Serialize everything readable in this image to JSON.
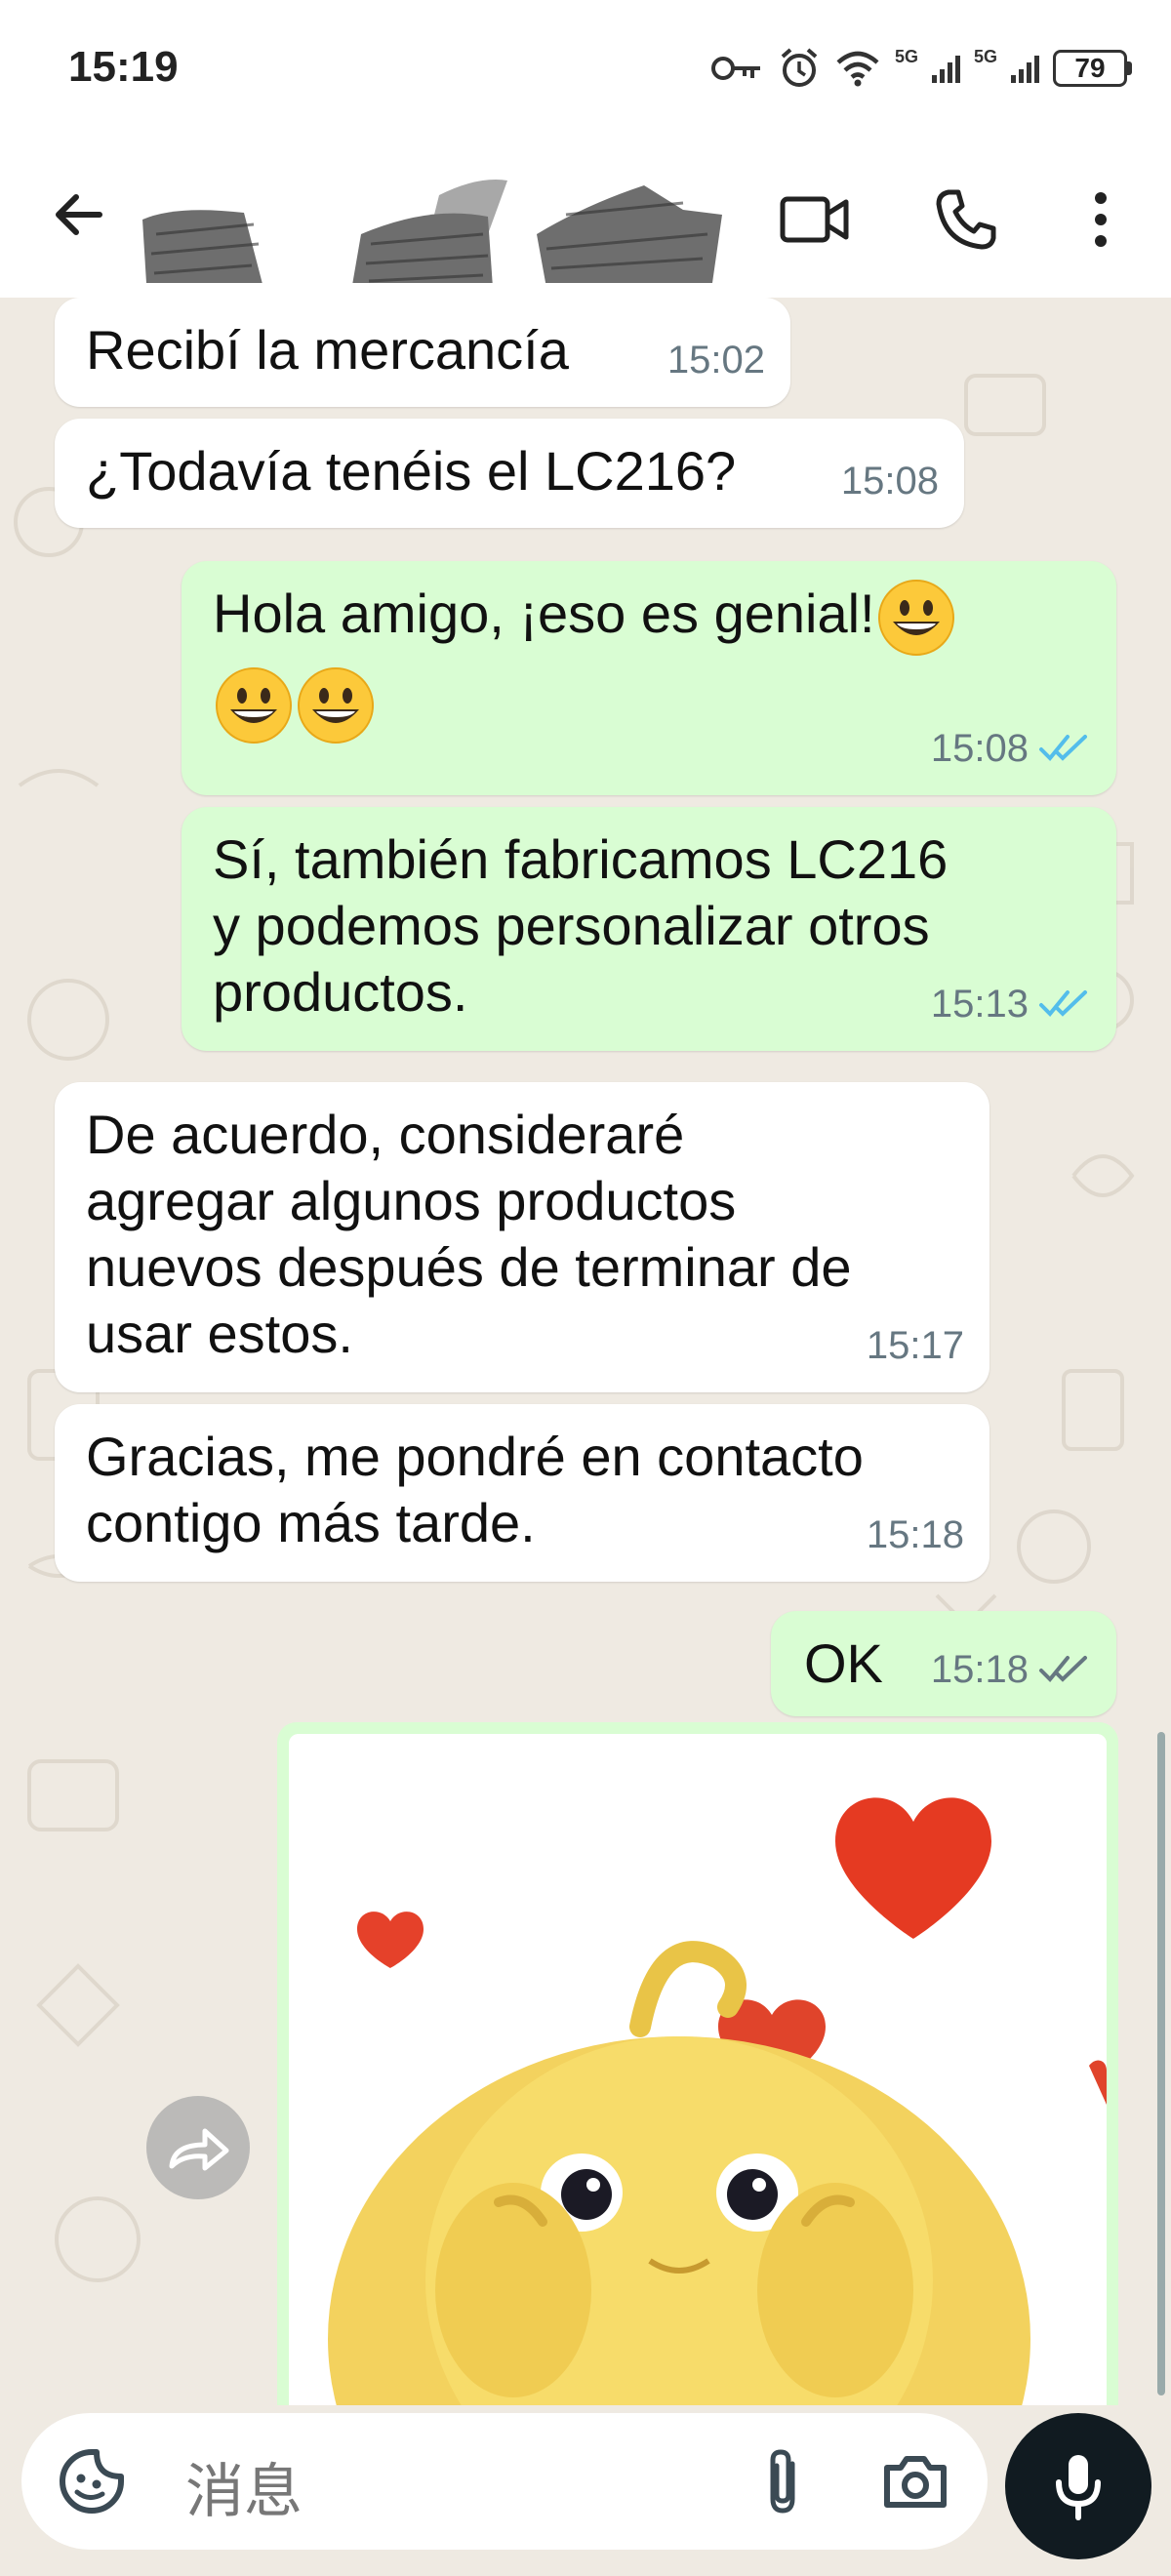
{
  "status_bar": {
    "time": "15:19",
    "battery": "79",
    "network_1": "5G",
    "network_2": "5G",
    "icons": [
      "key-icon",
      "alarm-icon",
      "wifi-icon",
      "signal-icon",
      "signal-icon",
      "battery-icon"
    ]
  },
  "header": {
    "icons": [
      "back-arrow-icon",
      "video-call-icon",
      "phone-icon",
      "more-vert-icon"
    ]
  },
  "messages": [
    {
      "direction": "in",
      "text": "Recibí la mercancía",
      "time": "15:02"
    },
    {
      "direction": "in",
      "text": "¿Todavía tenéis el LC216?",
      "time": "15:08"
    },
    {
      "direction": "out",
      "text_line1": "Hola amigo, ¡eso es genial!",
      "emoji": "grinning-face-emoji",
      "time": "15:08",
      "status": "read"
    },
    {
      "direction": "out",
      "lines": [
        "Sí, también fabricamos LC216",
        "y podemos personalizar otros",
        "productos."
      ],
      "time": "15:13",
      "status": "read"
    },
    {
      "direction": "in",
      "lines": [
        "De acuerdo, consideraré",
        "agregar algunos productos",
        "nuevos después de terminar de",
        "usar estos."
      ],
      "time": "15:17"
    },
    {
      "direction": "in",
      "lines": [
        "Gracias, me pondré en contacto",
        "contigo más tarde."
      ],
      "time": "15:18"
    },
    {
      "direction": "out",
      "text": "OK",
      "time": "15:18",
      "status": "delivered"
    },
    {
      "direction": "out",
      "type": "sticker",
      "sticker": "yellow-blob-hearts-sticker"
    }
  ],
  "composer": {
    "placeholder": "消息",
    "icons": [
      "sticker-icon",
      "attach-icon",
      "camera-icon",
      "mic-icon"
    ]
  },
  "colors": {
    "incoming_bubble": "#ffffff",
    "outgoing_bubble": "#d9fdd3",
    "read_tick": "#53bdeb",
    "delivered_tick": "#667781",
    "background": "#efeae2"
  }
}
